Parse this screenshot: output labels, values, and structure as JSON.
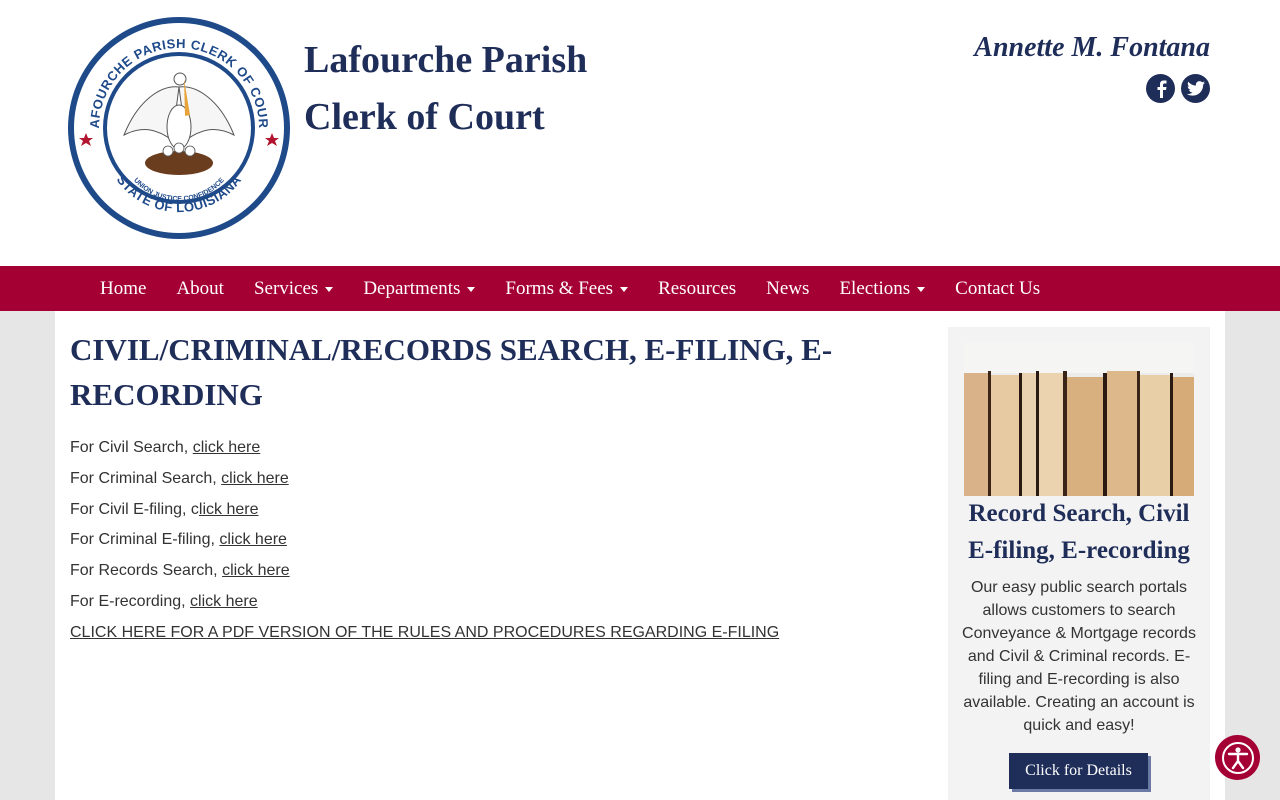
{
  "header": {
    "seal": {
      "top_text": "LAFOURCHE PARISH CLERK OF COURT",
      "motto": "UNION JUSTICE CONFIDENCE",
      "bottom_text": "STATE OF LOUISIANA"
    },
    "title_line1": "Lafourche Parish",
    "title_line2": "Clerk of Court",
    "clerk_name": "Annette M. Fontana",
    "social": [
      {
        "icon": "facebook-icon"
      },
      {
        "icon": "twitter-icon"
      }
    ]
  },
  "nav": {
    "items": [
      {
        "label": "Home",
        "dropdown": false
      },
      {
        "label": "About",
        "dropdown": false
      },
      {
        "label": "Services",
        "dropdown": true
      },
      {
        "label": "Departments",
        "dropdown": true
      },
      {
        "label": "Forms & Fees",
        "dropdown": true
      },
      {
        "label": "Resources",
        "dropdown": false
      },
      {
        "label": "News",
        "dropdown": false
      },
      {
        "label": "Elections",
        "dropdown": true
      },
      {
        "label": "Contact Us",
        "dropdown": false
      }
    ]
  },
  "main": {
    "title": "CIVIL/CRIMINAL/RECORDS SEARCH, E-FILING, E-RECORDING",
    "links": [
      {
        "prefix": "For Civil Search, ",
        "link": "click here"
      },
      {
        "prefix": "For Criminal Search, ",
        "link": "click here"
      },
      {
        "prefix": "For Civil E-filing, c",
        "link": "lick here"
      },
      {
        "prefix": "For Criminal E-filing, ",
        "link": "click here"
      },
      {
        "prefix": "For Records Search, ",
        "link": "click here"
      },
      {
        "prefix": "For E-recording, ",
        "link": "click here"
      }
    ],
    "pdf_link": "CLICK HERE FOR A PDF VERSION OF THE RULES AND PROCEDURES REGARDING E-FILING"
  },
  "sidebar": {
    "title": "Record Search, Civil E-filing, E-recording",
    "text": "Our easy public search portals allows customers to search Conveyance & Mortgage records and Civil & Criminal records. E-filing and E-recording is also available. Creating an account is quick and easy!",
    "button_label": "Click for Details"
  },
  "colors": {
    "navy": "#1f2d59",
    "maroon": "#a50034",
    "text": "#333333"
  }
}
